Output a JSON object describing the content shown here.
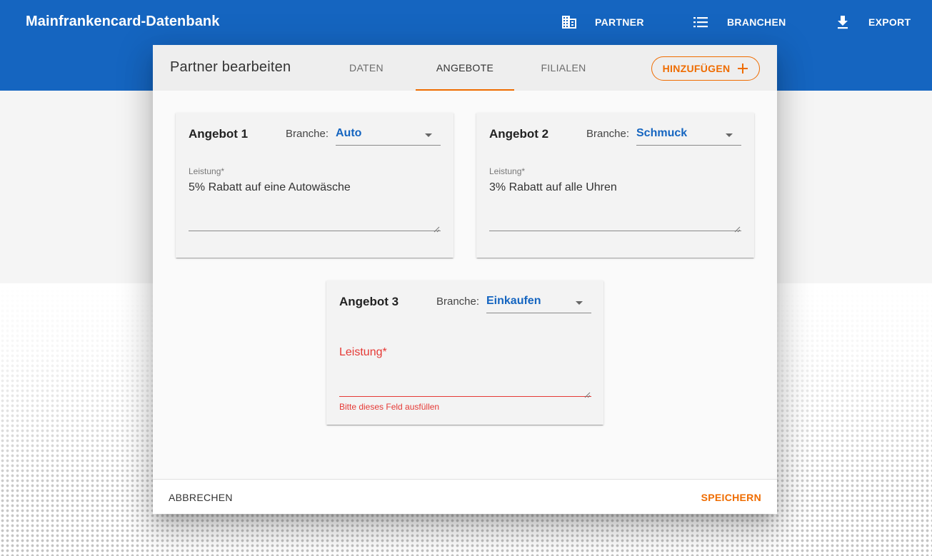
{
  "app": {
    "title": "Mainfrankencard-Datenbank"
  },
  "nav": {
    "partner": "PARTNER",
    "branchen": "BRANCHEN",
    "export": "EXPORT"
  },
  "dialog": {
    "title": "Partner bearbeiten",
    "tabs": {
      "daten": "DATEN",
      "angebote": "ANGEBOTE",
      "filialen": "FILIALEN"
    },
    "active_tab": "ANGEBOTE",
    "add_button": "HINZUFÜGEN",
    "offers": [
      {
        "title": "Angebot 1",
        "branche_label": "Branche:",
        "branche_value": "Auto",
        "leistung_label": "Leistung*",
        "leistung_value": "5% Rabatt auf eine Autowäsche"
      },
      {
        "title": "Angebot 2",
        "branche_label": "Branche:",
        "branche_value": "Schmuck",
        "leistung_label": "Leistung*",
        "leistung_value": "3% Rabatt auf alle Uhren"
      },
      {
        "title": "Angebot 3",
        "branche_label": "Branche:",
        "branche_value": "Einkaufen",
        "leistung_label": "Leistung*",
        "leistung_value": "",
        "error": "Bitte dieses Feld ausfüllen"
      }
    ],
    "footer": {
      "cancel": "ABBRECHEN",
      "save": "SPEICHERN"
    }
  },
  "colors": {
    "primary": "#1565c0",
    "accent": "#ef6c00",
    "error": "#e53935"
  }
}
